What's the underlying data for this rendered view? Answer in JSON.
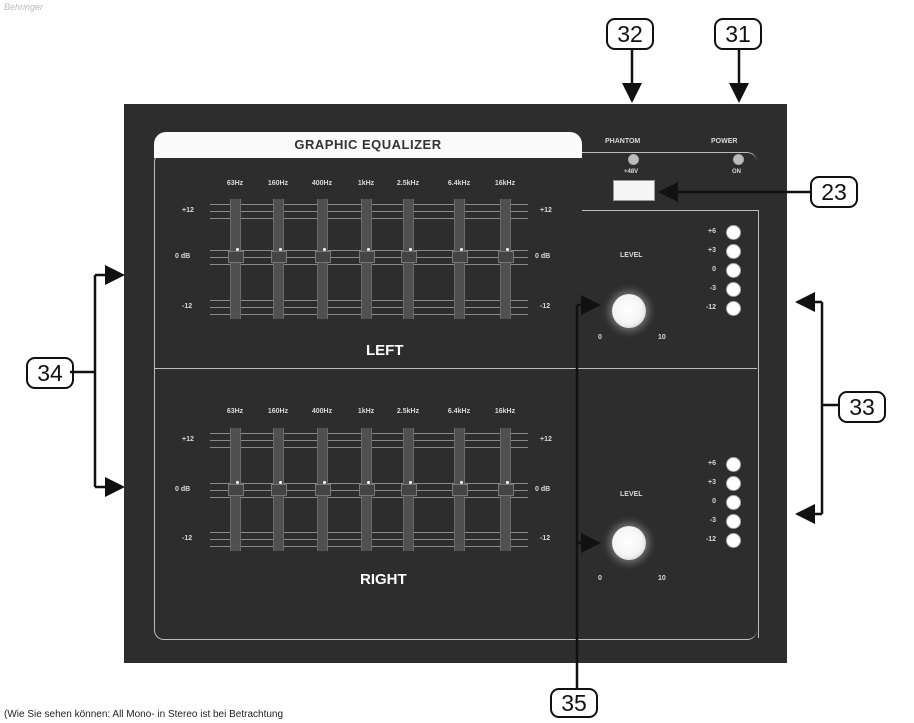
{
  "logo_text": "Behringer",
  "eq_title": "GRAPHIC EQUALIZER",
  "frequencies": [
    "63Hz",
    "160Hz",
    "400Hz",
    "1kHz",
    "2.5kHz",
    "6.4kHz",
    "16kHz"
  ],
  "db_labels": {
    "top": "+12",
    "mid": "0 dB",
    "bottom": "-12"
  },
  "channels": {
    "left": "LEFT",
    "right": "RIGHT"
  },
  "phantom": {
    "label": "PHANTOM",
    "sub": "+48V"
  },
  "power": {
    "label": "POWER",
    "sub": "ON"
  },
  "level": {
    "label": "LEVEL",
    "min": "0",
    "max": "10"
  },
  "meter_labels": [
    "+6",
    "+3",
    "0",
    "-3",
    "-12"
  ],
  "callouts": {
    "c31": "31",
    "c32": "32",
    "c23": "23",
    "c33": "33",
    "c34": "34",
    "c35": "35"
  },
  "caption": "(Wie Sie sehen können: All Mono- in Stereo ist bei Betrachtung"
}
